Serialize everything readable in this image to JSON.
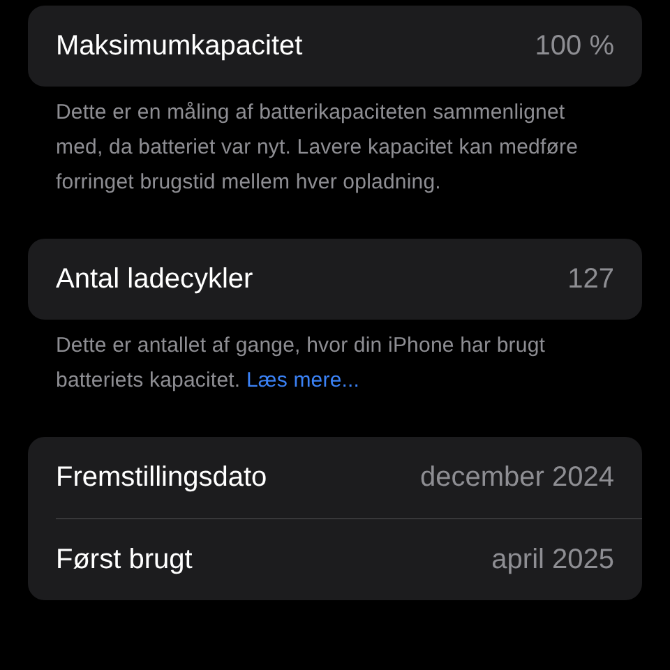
{
  "sections": [
    {
      "rows": [
        {
          "label": "Maksimumkapacitet",
          "value": "100 %"
        }
      ],
      "footer": {
        "text": "Dette er en måling af batterikapaciteten sammenlignet med, da batteriet var nyt. Lavere kapacitet kan medføre forringet brugstid mellem hver opladning."
      }
    },
    {
      "rows": [
        {
          "label": "Antal ladecykler",
          "value": "127"
        }
      ],
      "footer": {
        "text": "Dette er antallet af gange, hvor din iPhone har brugt batteriets kapacitet.",
        "link": "Læs mere..."
      }
    },
    {
      "rows": [
        {
          "label": "Fremstillingsdato",
          "value": "december 2024"
        },
        {
          "label": "Først brugt",
          "value": "april 2025"
        }
      ]
    }
  ]
}
